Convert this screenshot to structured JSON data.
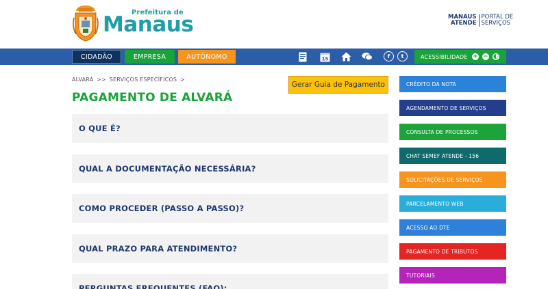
{
  "header": {
    "logo_small": "Prefeitura de",
    "logo_big": "Manaus",
    "portal_left_1": "MANAUS",
    "portal_left_2": "ATENDE",
    "portal_right_1": "PORTAL DE",
    "portal_right_2": "SERVIÇOS"
  },
  "nav": {
    "tabs": [
      {
        "label": "CIDADÃO"
      },
      {
        "label": "EMPRESA"
      },
      {
        "label": "AUTÔNOMO"
      }
    ],
    "accessibility_label": "ACESSIBILIDADE",
    "accessibility_buttons": [
      "+",
      "−",
      "◐"
    ],
    "icons": [
      "document-icon",
      "calendar-icon",
      "home-icon",
      "chat-icon",
      "facebook-icon",
      "twitter-icon"
    ],
    "calendar_day": "15",
    "facebook_glyph": "f",
    "twitter_glyph": "t"
  },
  "breadcrumb": {
    "items": [
      "ALVARÁ",
      ">>",
      "SERVIÇOS ESPECÍFICOS",
      ">"
    ]
  },
  "main": {
    "title": "PAGAMENTO DE ALVARÁ",
    "guia_button": "Gerar Guia de Pagamento",
    "faq": [
      {
        "label": "O QUE É?"
      },
      {
        "label": "QUAL A DOCUMENTAÇÃO NECESSÁRIA?"
      },
      {
        "label": "COMO PROCEDER (PASSO A PASSO)?"
      },
      {
        "label": "QUAL PRAZO PARA ATENDIMENTO?"
      },
      {
        "label": "PERGUNTAS FREQUENTES (FAQ):"
      }
    ]
  },
  "sidebar": {
    "items": [
      {
        "label": "CRÉDITO DA NOTA",
        "color": "#2b82d9"
      },
      {
        "label": "AGENDAMENTO DE SERVIÇOS",
        "color": "#233f8c"
      },
      {
        "label": "CONSULTA DE PROCESSOS",
        "color": "#1ea33a"
      },
      {
        "label": "CHAT SEMEF ATENDE - 156",
        "color": "#0f6b6b"
      },
      {
        "label": "SOLICITAÇÕES DE SERVIÇOS",
        "color": "#f7941d"
      },
      {
        "label": "PARCELAMENTO WEB",
        "color": "#29aedc"
      },
      {
        "label": "ACESSO AO DTE",
        "color": "#2f80d8"
      },
      {
        "label": "PAGAMENTO DE TRIBUTOS",
        "color": "#e52521"
      },
      {
        "label": "TUTORIAIS",
        "color": "#b424b9"
      }
    ]
  },
  "colors": {
    "navbar": "#2c5ea7",
    "accent_green": "#19a33b",
    "brand_teal": "#1f9ea6",
    "button_yellow": "#fcc10a"
  }
}
